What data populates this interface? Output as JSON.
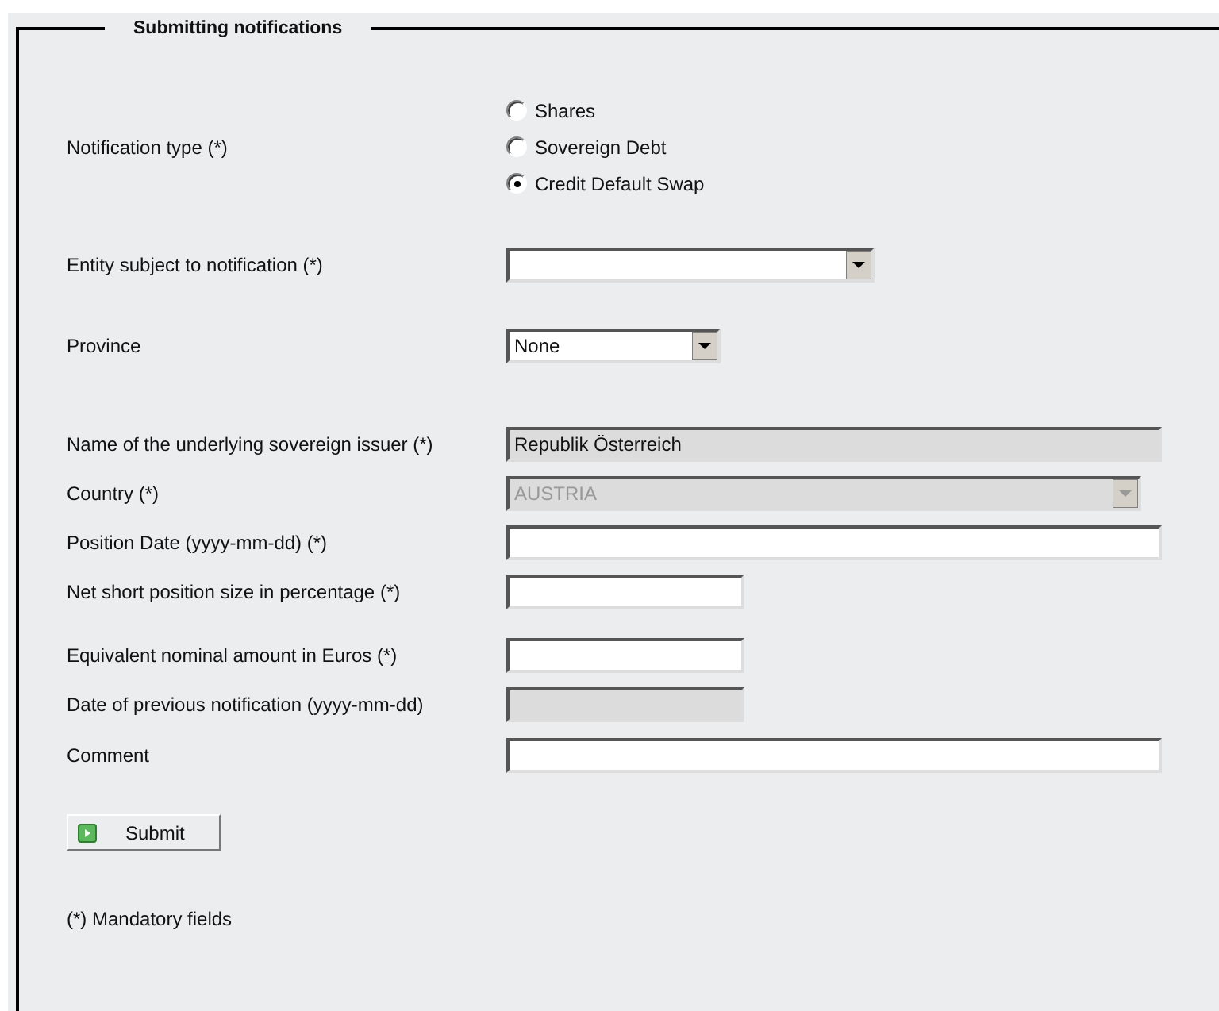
{
  "section": {
    "title": "Submitting notifications"
  },
  "fields": [
    {
      "kind": "radio",
      "label": "Notification type (*)",
      "options": [
        {
          "label": "Shares",
          "selected": false
        },
        {
          "label": "Sovereign Debt",
          "selected": false
        },
        {
          "label": "Credit Default Swap",
          "selected": true
        }
      ]
    },
    {
      "kind": "select",
      "label": "Entity subject to notification (*)",
      "disabled": false
    },
    {
      "kind": "select",
      "label": "Province",
      "value": "None",
      "disabled": false
    },
    {
      "kind": "text",
      "label": "Name of the underlying sovereign issuer (*)",
      "value": "Republik Österreich",
      "disabled": true
    },
    {
      "kind": "select",
      "label": "Country (*)",
      "value": "AUSTRIA",
      "disabled": true
    },
    {
      "kind": "text",
      "label": "Position Date (yyyy-mm-dd) (*)",
      "disabled": false
    },
    {
      "kind": "text",
      "label": "Net short position size in percentage (*)",
      "disabled": false
    },
    {
      "kind": "text",
      "label": "Equivalent nominal amount in Euros (*)",
      "disabled": false
    },
    {
      "kind": "text",
      "label": "Date of previous notification (yyyy-mm-dd)",
      "disabled": true
    },
    {
      "kind": "text",
      "label": "Comment",
      "disabled": false
    }
  ],
  "submit_button": "Submit",
  "footnote": "(*) Mandatory fields"
}
